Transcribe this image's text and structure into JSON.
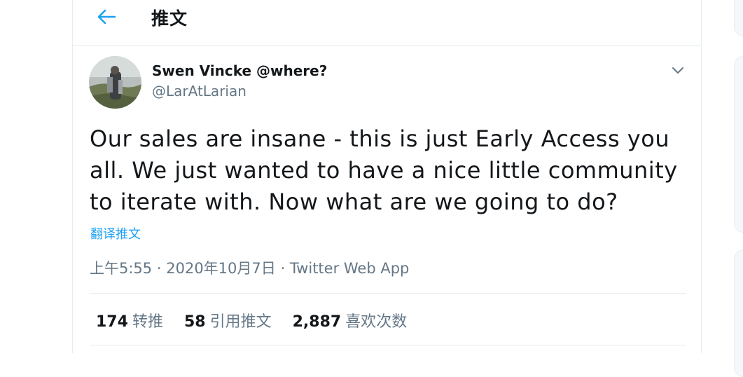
{
  "header": {
    "title": "推文"
  },
  "tweet": {
    "display_name": "Swen Vincke @where?",
    "handle": "@LarAtLarian",
    "text": "Our sales are insane - this is just Early Access you all. We just wanted to have a nice little community to iterate with. Now what are we going to do?",
    "translate_label": "翻译推文",
    "time": "上午5:55",
    "date": "2020年10月7日",
    "separator": "·",
    "source": "Twitter Web App"
  },
  "stats": {
    "retweets_count": "174",
    "retweets_label": "转推",
    "quotes_count": "58",
    "quotes_label": "引用推文",
    "likes_count": "2,887",
    "likes_label": "喜欢次数"
  },
  "colors": {
    "accent": "#1da1f2",
    "secondary_text": "#657786",
    "border": "#e6ecf0"
  },
  "icons": [
    "back-arrow-icon",
    "chevron-down-icon"
  ]
}
